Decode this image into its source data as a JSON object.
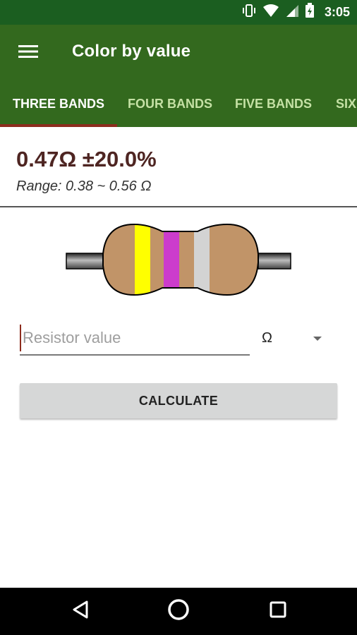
{
  "status_bar": {
    "time": "3:05",
    "icons": [
      "vibrate-icon",
      "wifi-icon",
      "signal-icon",
      "battery-icon"
    ]
  },
  "app_bar": {
    "title": "Color by value",
    "menu_icon": "menu-icon"
  },
  "tabs": [
    {
      "label": "THREE BANDS",
      "active": true
    },
    {
      "label": "FOUR BANDS",
      "active": false
    },
    {
      "label": "FIVE BANDS",
      "active": false
    },
    {
      "label": "SIX",
      "active": false
    }
  ],
  "result": {
    "value": "0.47Ω ±20.0%",
    "range": "Range: 0.38 ~ 0.56 Ω"
  },
  "resistor": {
    "body_color": "#c19468",
    "lead_color": "#555555",
    "bands": [
      {
        "color": "yellow",
        "hex": "#ffff00"
      },
      {
        "color": "violet",
        "hex": "#cc3ccc"
      },
      {
        "color": "gold",
        "hex": "#c19468"
      },
      {
        "color": "silver",
        "hex": "#d3d3d3"
      }
    ]
  },
  "input": {
    "value": "",
    "placeholder": "Resistor value"
  },
  "unit_select": {
    "selected": "Ω"
  },
  "calculate_button": {
    "label": "CALCULATE"
  },
  "nav_bar": {
    "icons": [
      "back-icon",
      "home-icon",
      "recents-icon"
    ]
  },
  "colors": {
    "status_bar": "#1b5e20",
    "app_bar": "#33691e",
    "accent": "#8d2c1e",
    "result_text": "#4e2522"
  }
}
